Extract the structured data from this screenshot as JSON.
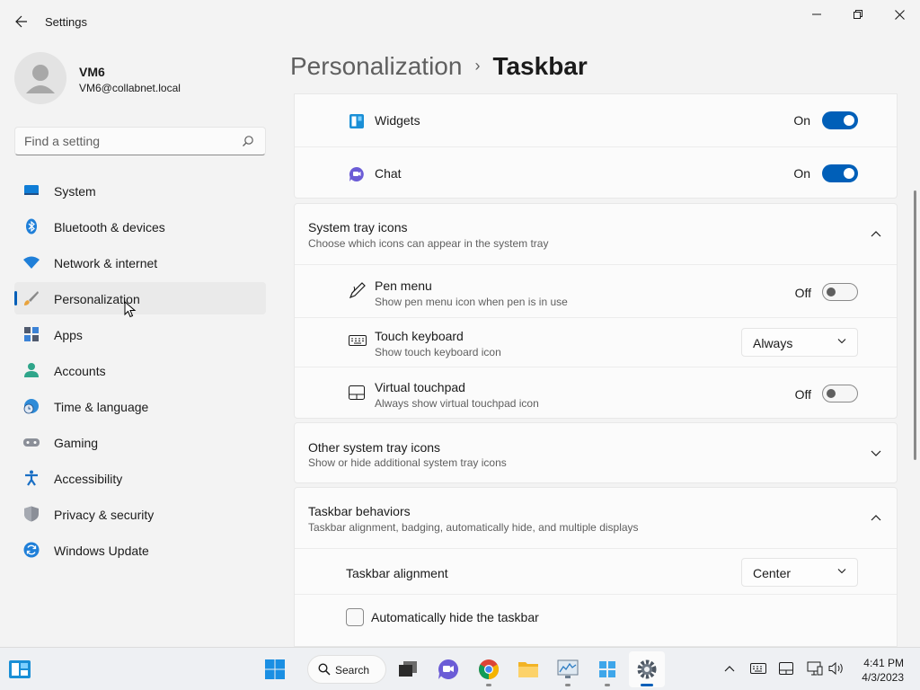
{
  "app": {
    "title": "Settings"
  },
  "user": {
    "name": "VM6",
    "email": "VM6@collabnet.local"
  },
  "search": {
    "placeholder": "Find a setting"
  },
  "sidebar": {
    "items": [
      {
        "label": "System",
        "icon": "system-icon"
      },
      {
        "label": "Bluetooth & devices",
        "icon": "bluetooth-icon"
      },
      {
        "label": "Network & internet",
        "icon": "wifi-icon"
      },
      {
        "label": "Personalization",
        "icon": "brush-icon",
        "selected": true
      },
      {
        "label": "Apps",
        "icon": "apps-icon"
      },
      {
        "label": "Accounts",
        "icon": "accounts-icon"
      },
      {
        "label": "Time & language",
        "icon": "globe-clock-icon"
      },
      {
        "label": "Gaming",
        "icon": "gamepad-icon"
      },
      {
        "label": "Accessibility",
        "icon": "accessibility-icon"
      },
      {
        "label": "Privacy & security",
        "icon": "shield-icon"
      },
      {
        "label": "Windows Update",
        "icon": "update-icon"
      }
    ]
  },
  "breadcrumb": {
    "parent": "Personalization",
    "separator": "›",
    "current": "Taskbar"
  },
  "taskbar_items": {
    "widgets": {
      "label": "Widgets",
      "state": "On"
    },
    "chat": {
      "label": "Chat",
      "state": "On"
    }
  },
  "system_tray": {
    "title": "System tray icons",
    "subtitle": "Choose which icons can appear in the system tray",
    "pen_menu": {
      "title": "Pen menu",
      "subtitle": "Show pen menu icon when pen is in use",
      "state": "Off"
    },
    "touch_keyboard": {
      "title": "Touch keyboard",
      "subtitle": "Show touch keyboard icon",
      "value": "Always"
    },
    "virtual_touchpad": {
      "title": "Virtual touchpad",
      "subtitle": "Always show virtual touchpad icon",
      "state": "Off"
    }
  },
  "other_tray": {
    "title": "Other system tray icons",
    "subtitle": "Show or hide additional system tray icons"
  },
  "behaviors": {
    "title": "Taskbar behaviors",
    "subtitle": "Taskbar alignment, badging, automatically hide, and multiple displays",
    "alignment": {
      "label": "Taskbar alignment",
      "value": "Center"
    },
    "autohide": {
      "label": "Automatically hide the taskbar",
      "checked": false
    }
  },
  "os_taskbar": {
    "search_label": "Search",
    "time": "4:41 PM",
    "date": "4/3/2023"
  },
  "colors": {
    "accent": "#005fb8",
    "background": "#f3f3f3",
    "card": "#fbfbfb"
  }
}
